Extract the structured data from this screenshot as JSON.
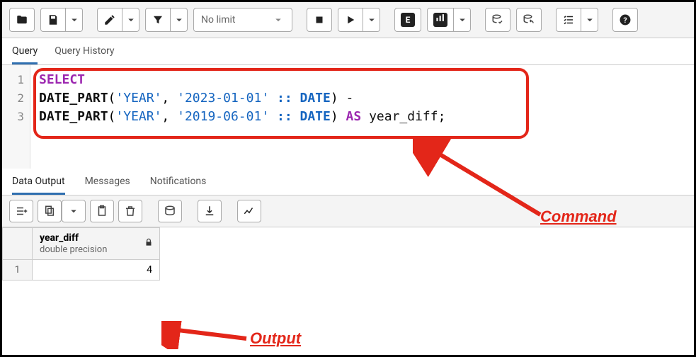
{
  "toolbar": {
    "limit_label": "No limit",
    "e_label": "E"
  },
  "tabs": {
    "query": "Query",
    "history": "Query History"
  },
  "editor": {
    "lines": [
      "1",
      "2",
      "3"
    ],
    "l1": {
      "select": "SELECT"
    },
    "l2": {
      "fn": "DATE_PART",
      "p1": "(",
      "s1": "'YEAR'",
      "c": ", ",
      "s2": "'2023-01-01'",
      "sp": " ",
      "cast": ":: DATE",
      "p2": ") ",
      "m": "-"
    },
    "l3": {
      "fn": "DATE_PART",
      "p1": "(",
      "s1": "'YEAR'",
      "c": ", ",
      "s2": "'2019-06-01'",
      "sp": " ",
      "cast": ":: DATE",
      "p2": ") ",
      "as": "AS",
      "id": " year_diff",
      "sc": ";"
    }
  },
  "out_tabs": {
    "data": "Data Output",
    "msg": "Messages",
    "notif": "Notifications"
  },
  "result": {
    "col_name": "year_diff",
    "col_type": "double precision",
    "row_num": "1",
    "value": "4"
  },
  "annot": {
    "command": "Command",
    "output": "Output"
  }
}
